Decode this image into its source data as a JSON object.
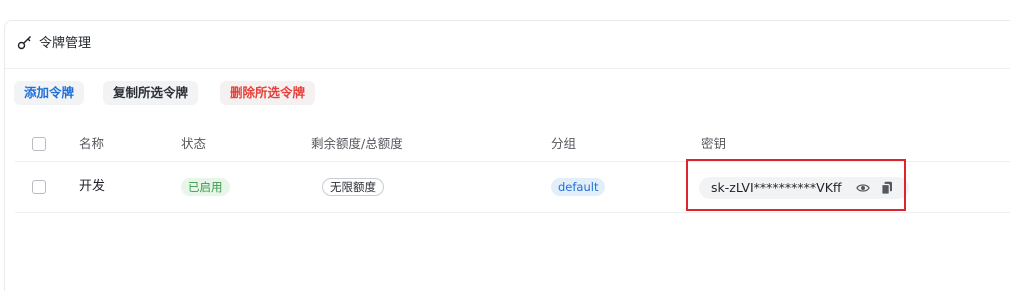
{
  "card": {
    "title": "令牌管理",
    "title_icon": "key-icon"
  },
  "toolbar": {
    "add_label": "添加令牌",
    "copy_label": "复制所选令牌",
    "delete_label": "删除所选令牌"
  },
  "table": {
    "columns": [
      "名称",
      "状态",
      "剩余额度/总额度",
      "分组",
      "密钥"
    ],
    "rows": [
      {
        "name": "开发",
        "status": "已启用",
        "quota": "无限额度",
        "group": "default",
        "secret": "sk-zLVI**********VKff"
      }
    ]
  },
  "colors": {
    "primary_blue": "#1f6fd6",
    "danger_red": "#e5403a",
    "status_green": "#3c9a4b",
    "highlight_red": "#d9262f"
  }
}
